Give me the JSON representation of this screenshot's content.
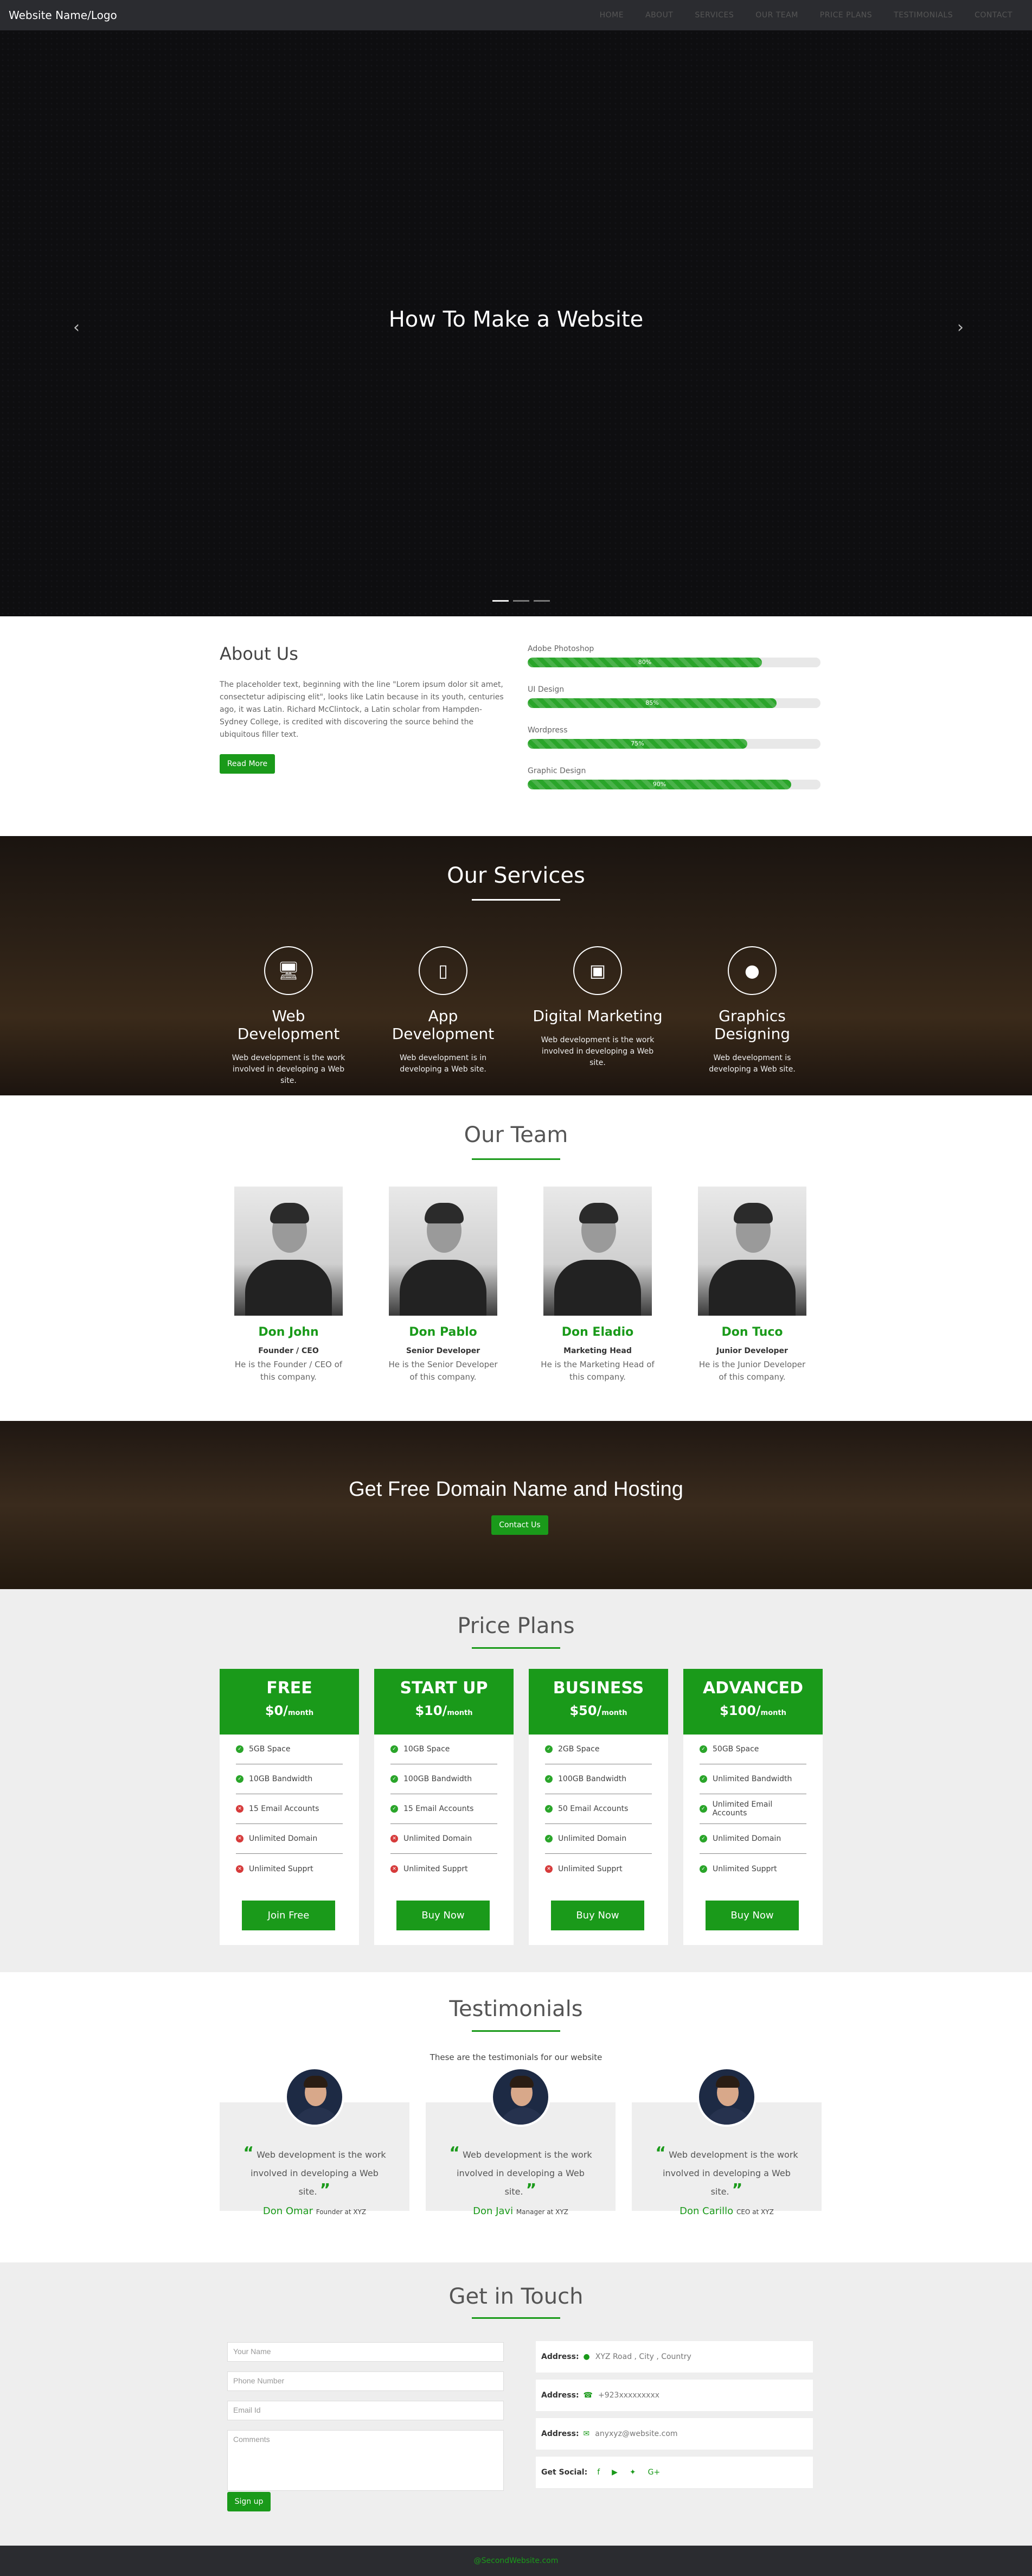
{
  "nav": {
    "brand": "Website Name/Logo",
    "items": [
      "HOME",
      "ABOUT",
      "SERVICES",
      "OUR TEAM",
      "PRICE PLANS",
      "TESTIMONIALS",
      "CONTACT"
    ]
  },
  "hero": {
    "title": "How To Make a Website",
    "prev_icon": "chevron-left-icon",
    "next_icon": "chevron-right-icon"
  },
  "about": {
    "title": "About Us",
    "text": "The placeholder text, beginning with the line \"Lorem ipsum dolor sit amet, consectetur adipiscing elit\", looks like Latin because in its youth, centuries ago, it was Latin. Richard McClintock, a Latin scholar from Hampden-Sydney College, is credited with discovering the source behind the ubiquitous filler text.",
    "button": "Read More",
    "skills": [
      {
        "name": "Adobe Photoshop",
        "label": "80%",
        "value": 0.8
      },
      {
        "name": "UI Design",
        "label": "85%",
        "value": 0.85
      },
      {
        "name": "Wordpress",
        "label": "75%",
        "value": 0.75
      },
      {
        "name": "Graphic Design",
        "label": "90%",
        "value": 0.9
      }
    ]
  },
  "services": {
    "title": "Our Services",
    "items": [
      {
        "icon": "desktop-icon",
        "title": "Web Development",
        "text": "Web development is the work involved in developing a Web site."
      },
      {
        "icon": "mobile-icon",
        "title": "App Development",
        "text": "Web development is in developing a Web site."
      },
      {
        "icon": "money-icon",
        "title": "Digital Marketing",
        "text": "Web development is the work involved in developing a Web site."
      },
      {
        "icon": "paw-icon",
        "title": "Graphics Designing",
        "text": "Web development is developing a Web site."
      }
    ]
  },
  "team": {
    "title": "Our Team",
    "members": [
      {
        "name": "Don John",
        "role": "Founder / CEO",
        "text": "He is the Founder / CEO of this company."
      },
      {
        "name": "Don Pablo",
        "role": "Senior Developer",
        "text": "He is the Senior Developer of this company."
      },
      {
        "name": "Don Eladio",
        "role": "Marketing Head",
        "text": "He is the Marketing Head of this company."
      },
      {
        "name": "Don Tuco",
        "role": "Junior Developer",
        "text": "He is the Junior Developer of this company."
      }
    ]
  },
  "domain": {
    "title": "Get Free Domain Name and Hosting",
    "button": "Contact Us"
  },
  "prices": {
    "title": "Price Plans",
    "plans": [
      {
        "name": "FREE",
        "price": "$0/",
        "unit": "month",
        "button": "Join Free",
        "features": [
          [
            "5GB Space",
            true
          ],
          [
            "10GB Bandwidth",
            true
          ],
          [
            "15 Email Accounts",
            false
          ],
          [
            "Unlimited Domain",
            false
          ],
          [
            "Unlimited Supprt",
            false
          ]
        ]
      },
      {
        "name": "START UP",
        "price": "$10/",
        "unit": "month",
        "button": "Buy Now",
        "features": [
          [
            "10GB Space",
            true
          ],
          [
            "100GB Bandwidth",
            true
          ],
          [
            "15 Email Accounts",
            true
          ],
          [
            "Unlimited Domain",
            false
          ],
          [
            "Unlimited Supprt",
            false
          ]
        ]
      },
      {
        "name": "BUSINESS",
        "price": "$50/",
        "unit": "month",
        "button": "Buy Now",
        "features": [
          [
            "2GB Space",
            true
          ],
          [
            "100GB Bandwidth",
            true
          ],
          [
            "50 Email Accounts",
            true
          ],
          [
            "Unlimited Domain",
            true
          ],
          [
            "Unlimited Supprt",
            false
          ]
        ]
      },
      {
        "name": "ADVANCED",
        "price": "$100/",
        "unit": "month",
        "button": "Buy Now",
        "features": [
          [
            "50GB Space",
            true
          ],
          [
            "Unlimited Bandwidth",
            true
          ],
          [
            "Unlimited Email Accounts",
            true
          ],
          [
            "Unlimited Domain",
            true
          ],
          [
            "Unlimited Supprt",
            true
          ]
        ]
      }
    ]
  },
  "testimonials": {
    "title": "Testimonials",
    "subtitle": "These are the testimonials for our website",
    "items": [
      {
        "quote": "Web development is the work involved in developing a Web site.",
        "name": "Don Omar",
        "role": "Founder at XYZ"
      },
      {
        "quote": "Web development is the work involved in developing a Web site.",
        "name": "Don Javi",
        "role": "Manager at XYZ"
      },
      {
        "quote": "Web development is the work involved in developing a Web site.",
        "name": "Don Carillo",
        "role": "CEO at XYZ"
      }
    ]
  },
  "contact": {
    "title": "Get in Touch",
    "placeholders": {
      "name": "Your Name",
      "phone": "Phone Number",
      "email": "Email Id",
      "comments": "Comments"
    },
    "button": "Sign up",
    "info": [
      {
        "label": "Address:",
        "icon": "map-marker-icon",
        "value": "XYZ Road , City , Country"
      },
      {
        "label": "Address:",
        "icon": "phone-icon",
        "value": "+923xxxxxxxxx"
      },
      {
        "label": "Address:",
        "icon": "envelope-icon",
        "value": "anyxyz@website.com"
      }
    ],
    "social_label": "Get Social:",
    "social": [
      "facebook-icon",
      "youtube-icon",
      "twitter-icon",
      "google-plus-icon"
    ]
  },
  "footer": {
    "text": "@SecondWebsite.com"
  },
  "colors": {
    "accent": "#1a9a1a",
    "nav": "#2b2c30"
  }
}
